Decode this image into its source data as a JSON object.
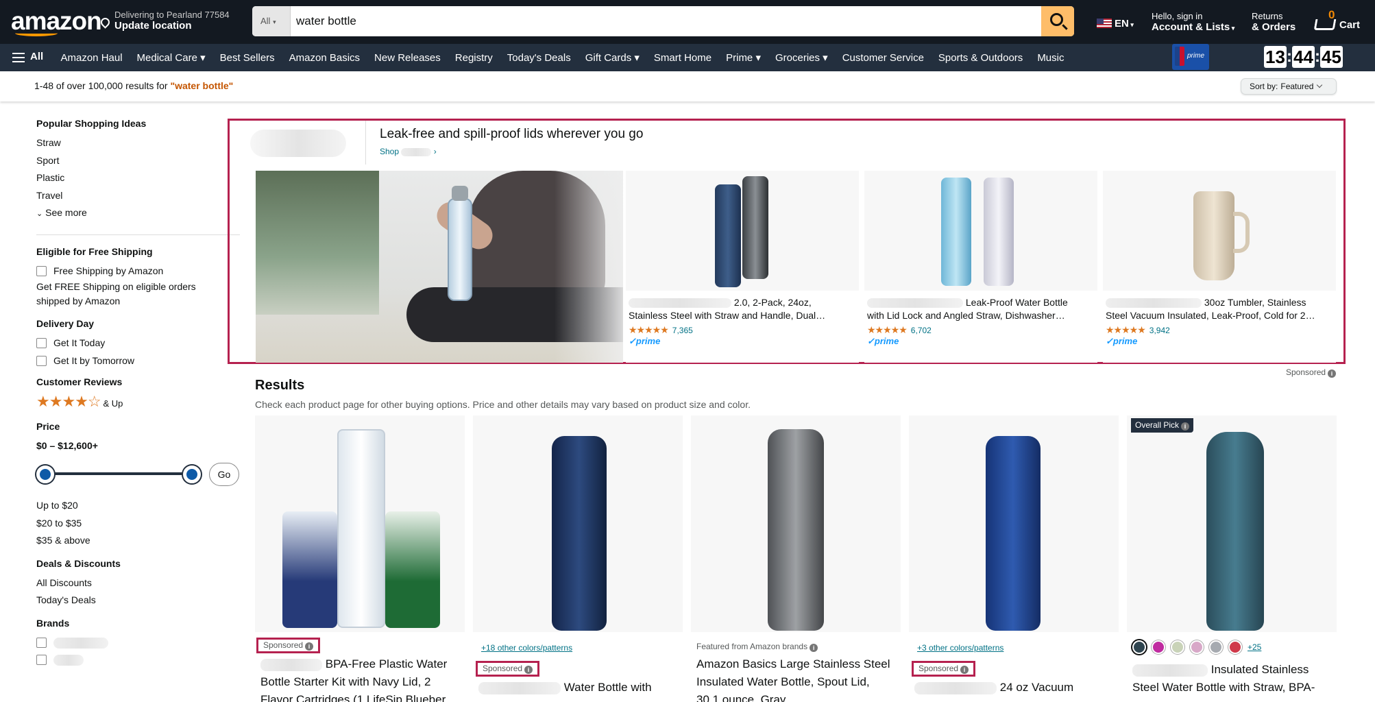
{
  "header": {
    "logo": "amazon",
    "deliver_line1": "Delivering to Pearland 77584",
    "deliver_line2": "Update location",
    "search_category": "All",
    "search_value": "water bottle",
    "lang": "EN",
    "account_line1": "Hello, sign in",
    "account_line2": "Account & Lists",
    "returns_line1": "Returns",
    "returns_line2": "& Orders",
    "cart_count": "0",
    "cart_label": "Cart"
  },
  "nav": {
    "all": "All",
    "items": [
      "Amazon Haul",
      "Medical Care ▾",
      "Best Sellers",
      "Amazon Basics",
      "New Releases",
      "Registry",
      "Today's Deals",
      "Gift Cards ▾",
      "Smart Home",
      "Prime ▾",
      "Groceries ▾",
      "Customer Service",
      "Sports & Outdoors",
      "Music"
    ],
    "timer": [
      "13",
      "44",
      "45"
    ]
  },
  "results_bar": {
    "count_text": "1-48 of over 100,000 results for ",
    "query": "\"water bottle\"",
    "sort_label": "Sort by:",
    "sort_value": "Featured"
  },
  "sidebar": {
    "popular_title": "Popular Shopping Ideas",
    "popular_items": [
      "Straw",
      "Sport",
      "Plastic",
      "Travel"
    ],
    "see_more": "See more",
    "free_ship_title": "Eligible for Free Shipping",
    "free_ship_option": "Free Shipping by Amazon",
    "free_ship_note": "Get FREE Shipping on eligible orders shipped by Amazon",
    "delivery_title": "Delivery Day",
    "delivery_options": [
      "Get It Today",
      "Get It by Tomorrow"
    ],
    "reviews_title": "Customer Reviews",
    "reviews_stars": "★★★★☆",
    "reviews_up": "& Up",
    "price_title": "Price",
    "price_range": "$0 – $12,600+",
    "go": "Go",
    "price_buckets": [
      "Up to $20",
      "$20 to $35",
      "$35 & above"
    ],
    "deals_title": "Deals & Discounts",
    "deals_items": [
      "All Discounts",
      "Today's Deals"
    ],
    "brands_title": "Brands"
  },
  "banner": {
    "headline": "Leak-free and spill-proof lids wherever you go",
    "shop": "Shop",
    "cards": [
      {
        "title_a": "2.0, 2-Pack, 24oz,",
        "title_b": "Stainless Steel with Straw and Handle, Dual…",
        "stars": "★★★★★",
        "count": "7,365",
        "prime": "✓prime"
      },
      {
        "title_a": "Leak-Proof Water Bottle",
        "title_b": "with Lid Lock and Angled Straw, Dishwasher…",
        "stars": "★★★★★",
        "count": "6,702",
        "prime": "✓prime"
      },
      {
        "title_a": "30oz Tumbler, Stainless",
        "title_b": "Steel Vacuum Insulated, Leak-Proof, Cold for 2…",
        "stars": "★★★★★",
        "count": "3,942",
        "prime": "✓prime"
      }
    ],
    "sponsored": "Sponsored"
  },
  "results": {
    "heading": "Results",
    "subtext": "Check each product page for other buying options. Price and other details may vary based on product size and color.",
    "products": [
      {
        "badge": "Sponsored",
        "title_l1": "BPA-Free Plastic Water",
        "title_l2": "Bottle Starter Kit with Navy Lid, 2",
        "title_l3": "Flavor Cartridges (1 LifeSip Blueber…"
      },
      {
        "link": "+18 other colors/patterns",
        "badge": "Sponsored",
        "title_l1": "Water Bottle with"
      },
      {
        "featured": "Featured from Amazon brands",
        "title_l1": "Amazon Basics Large Stainless Steel",
        "title_l2": "Insulated Water Bottle, Spout Lid,",
        "title_l3": "30.1 ounce, Gray"
      },
      {
        "link": "+3 other colors/patterns",
        "badge": "Sponsored",
        "title_l1": "24 oz Vacuum"
      },
      {
        "overall": "Overall Pick",
        "more_colors": "+25",
        "title_l1": "Insulated Stainless",
        "title_l2": "Steel Water Bottle with Straw, BPA-"
      }
    ],
    "swatch_colors": [
      "#2f4550",
      "#c02ca0",
      "#c9d3b8",
      "#d8a8c8",
      "#a6aab0",
      "#d0394a"
    ]
  }
}
